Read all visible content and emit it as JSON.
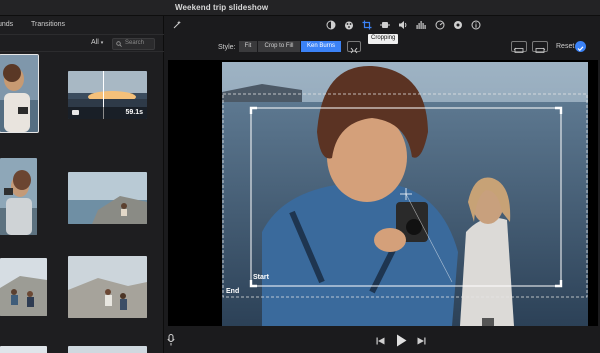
{
  "window": {
    "title": "Weekend trip slideshow"
  },
  "browser": {
    "tabs": [
      "unds",
      "Transitions"
    ],
    "filter_label": "All",
    "search_placeholder": "Search",
    "clips": [
      {
        "kind": "photo"
      },
      {
        "kind": "video",
        "duration": "59.1s"
      },
      {
        "kind": "photo"
      },
      {
        "kind": "photo"
      },
      {
        "kind": "photo"
      },
      {
        "kind": "photo"
      },
      {
        "kind": "photo"
      },
      {
        "kind": "photo"
      }
    ]
  },
  "toolbar": {
    "icons": [
      "magic-wand-icon",
      "color-balance-icon",
      "color-correction-icon",
      "cropping-icon",
      "stabilization-icon",
      "volume-icon",
      "noise-reduction-icon",
      "speed-icon",
      "filter-icon",
      "info-icon"
    ],
    "tooltip": "Cropping"
  },
  "style": {
    "label": "Style:",
    "options": [
      "Fit",
      "Crop to Fill",
      "Ken Burns"
    ],
    "selected": "Ken Burns",
    "reset_label": "Reset"
  },
  "viewer": {
    "start_label": "Start",
    "end_label": "End"
  },
  "colors": {
    "accent": "#3b82f6",
    "background": "#1b1b1d"
  }
}
